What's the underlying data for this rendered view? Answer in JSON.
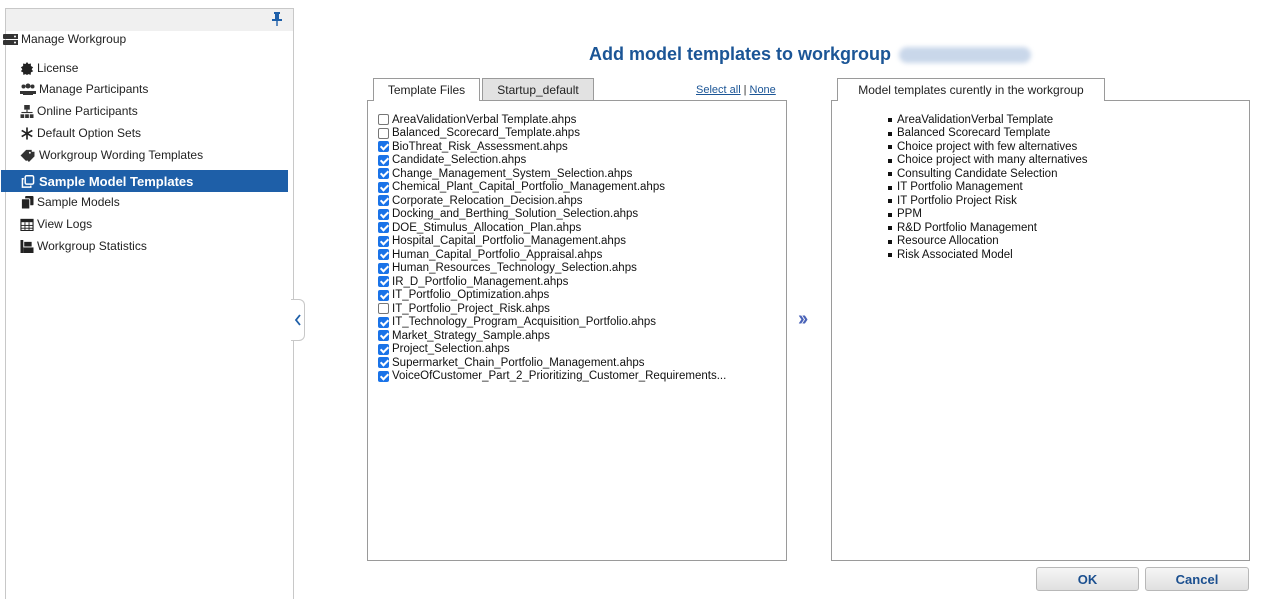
{
  "sidebar": {
    "root_label": "Manage Workgroup",
    "items": [
      {
        "label": "License",
        "icon": "certificate-icon"
      },
      {
        "label": "Manage Participants",
        "icon": "users-icon"
      },
      {
        "label": "Online Participants",
        "icon": "network-icon"
      },
      {
        "label": "Default Option Sets",
        "icon": "asterisk-icon"
      },
      {
        "label": "Workgroup Wording Templates",
        "icon": "tags-icon"
      },
      {
        "label": "Sample Model Templates",
        "icon": "copy-icon",
        "active": true
      },
      {
        "label": "Sample Models",
        "icon": "documents-icon"
      },
      {
        "label": "View Logs",
        "icon": "calendar-icon"
      },
      {
        "label": "Workgroup Statistics",
        "icon": "statistics-icon"
      }
    ]
  },
  "header": {
    "title": "Add model templates to workgroup"
  },
  "left_tabs": [
    "Template Files",
    "Startup_default"
  ],
  "select_all_label": "Select all",
  "select_none_label": "None",
  "files": [
    {
      "name": "AreaValidationVerbal Template.ahps",
      "checked": false
    },
    {
      "name": "Balanced_Scorecard_Template.ahps",
      "checked": false
    },
    {
      "name": "BioThreat_Risk_Assessment.ahps",
      "checked": true
    },
    {
      "name": "Candidate_Selection.ahps",
      "checked": true
    },
    {
      "name": "Change_Management_System_Selection.ahps",
      "checked": true
    },
    {
      "name": "Chemical_Plant_Capital_Portfolio_Management.ahps",
      "checked": true
    },
    {
      "name": "Corporate_Relocation_Decision.ahps",
      "checked": true
    },
    {
      "name": "Docking_and_Berthing_Solution_Selection.ahps",
      "checked": true
    },
    {
      "name": "DOE_Stimulus_Allocation_Plan.ahps",
      "checked": true
    },
    {
      "name": "Hospital_Capital_Portfolio_Management.ahps",
      "checked": true
    },
    {
      "name": "Human_Capital_Portfolio_Appraisal.ahps",
      "checked": true
    },
    {
      "name": "Human_Resources_Technology_Selection.ahps",
      "checked": true
    },
    {
      "name": "IR_D_Portfolio_Management.ahps",
      "checked": true
    },
    {
      "name": "IT_Portfolio_Optimization.ahps",
      "checked": true
    },
    {
      "name": "IT_Portfolio_Project_Risk.ahps",
      "checked": false
    },
    {
      "name": "IT_Technology_Program_Acquisition_Portfolio.ahps",
      "checked": true
    },
    {
      "name": "Market_Strategy_Sample.ahps",
      "checked": true
    },
    {
      "name": "Project_Selection.ahps",
      "checked": true
    },
    {
      "name": "Supermarket_Chain_Portfolio_Management.ahps",
      "checked": true
    },
    {
      "name": "VoiceOfCustomer_Part_2_Prioritizing_Customer_Requirements...",
      "checked": true
    }
  ],
  "right_tab": "Model templates curently in the workgroup",
  "current_templates": [
    "AreaValidationVerbal Template",
    "Balanced Scorecard Template",
    "Choice project with few alternatives",
    "Choice project with many alternatives",
    "Consulting Candidate Selection",
    "IT Portfolio Management",
    "IT Portfolio Project Risk",
    "PPM",
    "R&D Portfolio Management",
    "Resource Allocation",
    "Risk Associated Model"
  ],
  "buttons": {
    "ok": "OK",
    "cancel": "Cancel"
  },
  "colors": {
    "accent": "#1e5fa8",
    "title": "#1b5596",
    "checkbox": "#1a73e8",
    "arrow": "#4a63b8"
  }
}
